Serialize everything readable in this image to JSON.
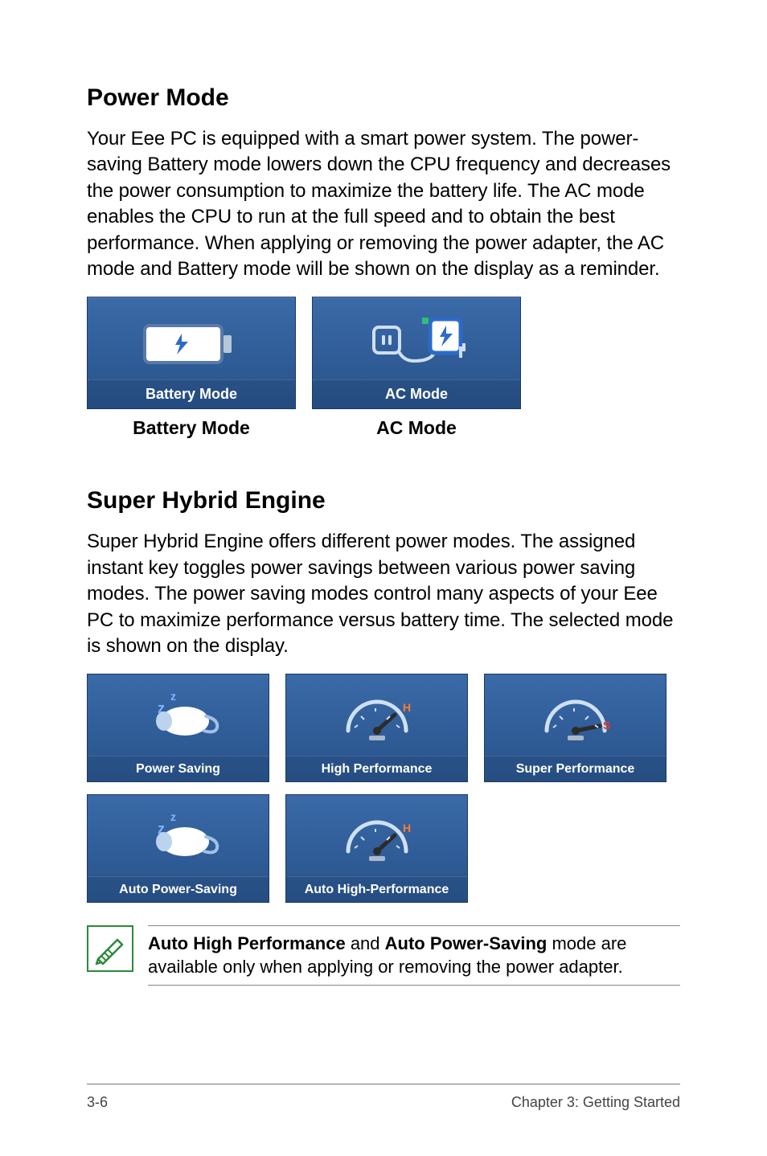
{
  "section1": {
    "title": "Power Mode",
    "body": "Your Eee PC is equipped with a smart power system. The power-saving Battery mode lowers down the CPU frequency and decreases the power consumption to maximize the battery life. The AC mode enables the CPU to run at the full speed and to obtain the best performance. When applying or removing the power adapter, the AC mode and Battery mode will be shown on the display as a reminder.",
    "panels": [
      {
        "bar_label": "Battery Mode",
        "caption": "Battery Mode"
      },
      {
        "bar_label": "AC Mode",
        "caption": "AC Mode"
      }
    ]
  },
  "section2": {
    "title": "Super Hybrid Engine",
    "body": "Super Hybrid Engine offers different power modes. The assigned instant key toggles power savings between various power saving modes. The power saving modes control many aspects of your Eee PC to maximize performance versus battery time. The selected mode is shown on the display.",
    "tiles": [
      {
        "label": "Power Saving"
      },
      {
        "label": "High Performance"
      },
      {
        "label": "Super Performance"
      },
      {
        "label": "Auto Power-Saving"
      },
      {
        "label": "Auto High-Performance"
      }
    ]
  },
  "note": {
    "bold1": "Auto High Performance",
    "mid": " and ",
    "bold2": "Auto Power-Saving",
    "tail": " mode are available only when applying or removing the power adapter."
  },
  "footer": {
    "page": "3-6",
    "chapter": "Chapter 3: Getting Started"
  }
}
